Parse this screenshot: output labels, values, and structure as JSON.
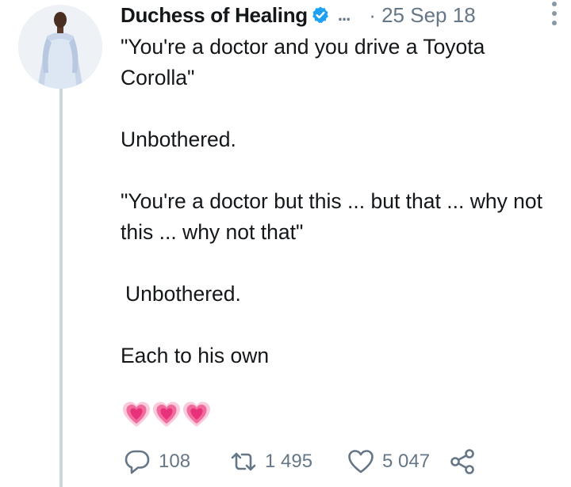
{
  "tweet": {
    "author_name": "Duchess of Healing",
    "truncation": "...",
    "date": "· 25 Sep 18",
    "paragraphs": [
      "\"You're a doctor and you drive a Toyota Corolla\"",
      "Unbothered.",
      "\"You're a doctor but this ... but that ... why not this ... why not that\"",
      "Unbothered.",
      "Each to his own"
    ],
    "emoji": [
      "growing-heart",
      "growing-heart",
      "growing-heart"
    ]
  },
  "actions": {
    "reply_count": "108",
    "retweet_count": "1 495",
    "like_count": "5 047"
  },
  "icons": {
    "verified": "verified-badge-icon",
    "more": "more-vertical-icon",
    "reply": "reply-icon",
    "retweet": "retweet-icon",
    "like": "heart-outline-icon",
    "share": "share-icon"
  },
  "colors": {
    "verified_blue": "#1da1f2",
    "muted_text": "#657786",
    "thread_line": "#ccd6dd",
    "heart_pink": "#f06a9b"
  }
}
